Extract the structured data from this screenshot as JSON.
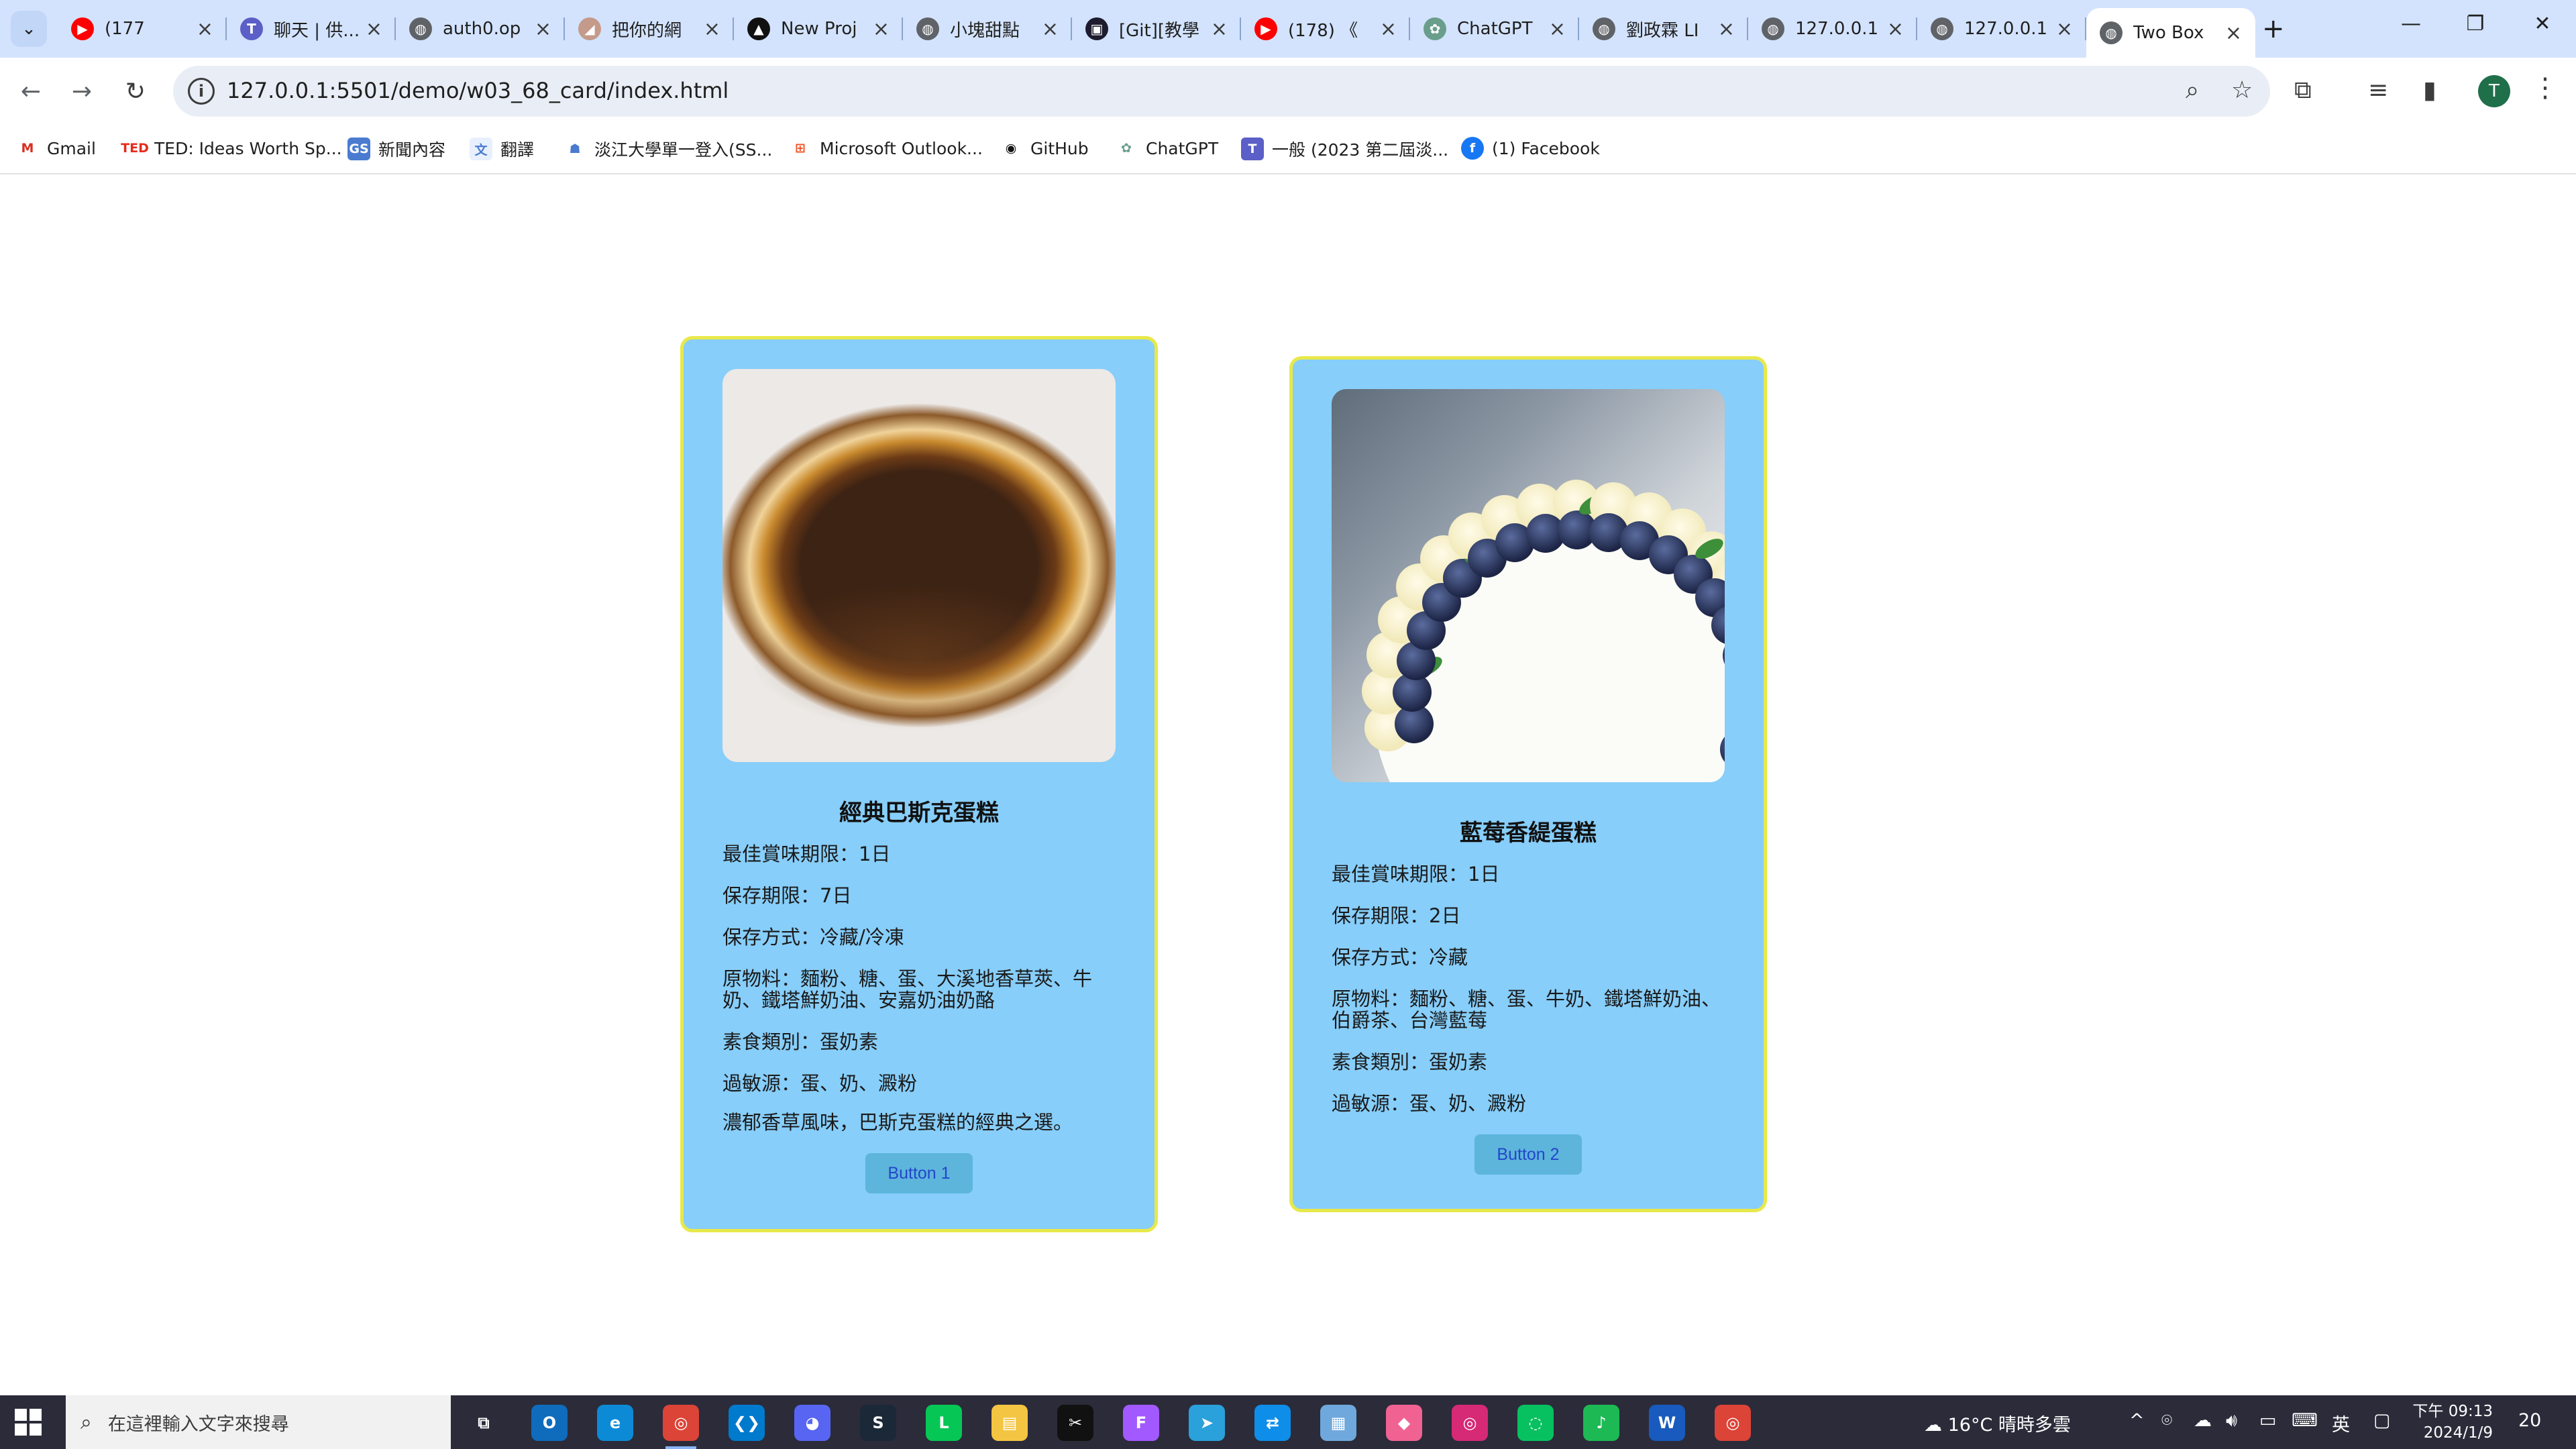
{
  "browser": {
    "tabs": [
      {
        "label": "(177",
        "icon": "youtube-icon",
        "color": "#ff0000"
      },
      {
        "label": "聊天 | 供...",
        "icon": "teams-icon",
        "color": "#5b5fc7"
      },
      {
        "label": "auth0.op",
        "icon": "globe-icon",
        "color": "#5f6368"
      },
      {
        "label": "把你的網",
        "icon": "mountain-icon",
        "color": "#c49a8a"
      },
      {
        "label": "New Proj",
        "icon": "triangle-icon",
        "color": "#111111"
      },
      {
        "label": "小塊甜點",
        "icon": "globe-icon",
        "color": "#5f6368"
      },
      {
        "label": "[Git][教學",
        "icon": "square-logo-icon",
        "color": "#1e1b2e"
      },
      {
        "label": "(178) 《",
        "icon": "youtube-icon",
        "color": "#ff0000"
      },
      {
        "label": "ChatGPT",
        "icon": "chatgpt-icon",
        "color": "#6a9e8c"
      },
      {
        "label": "劉政霖 LI",
        "icon": "globe-icon",
        "color": "#5f6368"
      },
      {
        "label": "127.0.0.1",
        "icon": "globe-icon",
        "color": "#5f6368"
      },
      {
        "label": "127.0.0.1",
        "icon": "globe-icon",
        "color": "#5f6368"
      },
      {
        "label": "Two Box",
        "icon": "globe-icon",
        "color": "#5f6368"
      }
    ],
    "new_tab": "+",
    "url": "127.0.0.1:5501/demo/w03_68_card/index.html",
    "profile_initial": "T",
    "bookmarks": [
      {
        "label": "Gmail",
        "icon": "gmail-icon"
      },
      {
        "label": "TED: Ideas Worth Sp...",
        "icon": "ted-icon",
        "icon_text": "TED"
      },
      {
        "label": "新聞內容",
        "icon": "gs-icon",
        "icon_text": "GS"
      },
      {
        "label": "翻譯",
        "icon": "translate-icon"
      },
      {
        "label": "淡江大學單一登入(SS...",
        "icon": "tku-icon"
      },
      {
        "label": "Microsoft Outlook...",
        "icon": "microsoft-icon"
      },
      {
        "label": "GitHub",
        "icon": "github-icon"
      },
      {
        "label": "ChatGPT",
        "icon": "chatgpt-icon"
      },
      {
        "label": "一般 (2023 第二屆淡...",
        "icon": "teams-icon"
      },
      {
        "label": "(1) Facebook",
        "icon": "facebook-icon",
        "icon_text": "f"
      }
    ]
  },
  "cards": [
    {
      "title": "經典巴斯克蛋糕",
      "image": "basque-cheesecake-photo",
      "specs": [
        "最佳賞味期限：1日",
        "保存期限：7日",
        "保存方式：冷藏/冷凍",
        "原物料：麵粉、糖、蛋、大溪地香草莢、牛奶、鐵塔鮮奶油、安嘉奶油奶酪",
        "素食類別：蛋奶素",
        "過敏源：蛋、奶、澱粉"
      ],
      "description": "濃郁香草風味，巴斯克蛋糕的經典之選。",
      "button": "Button 1"
    },
    {
      "title": "藍莓香緹蛋糕",
      "image": "blueberry-chantilly-cake-photo",
      "specs": [
        "最佳賞味期限：1日",
        "保存期限：2日",
        "保存方式：冷藏",
        "原物料：麵粉、糖、蛋、牛奶、鐵塔鮮奶油、伯爵茶、台灣藍莓",
        "素食類別：蛋奶素",
        "過敏源：蛋、奶、澱粉"
      ],
      "button": "Button 2"
    }
  ],
  "colors": {
    "card_bg": "#87cefa",
    "card_border": "#e8e84a",
    "button_bg": "#5db5dc",
    "button_text": "#2446c9",
    "tab_strip": "#d3e3fd",
    "taskbar": "#2b2b3a"
  },
  "taskbar": {
    "search_placeholder": "在這裡輸入文字來搜尋",
    "weather": "16°C  晴時多雲",
    "ime": "英",
    "time": "下午 09:13",
    "date": "2024/1/9",
    "notification_count": "20",
    "apps": [
      "task-view-icon",
      "outlook-icon",
      "edge-icon",
      "chrome-icon",
      "vscode-icon",
      "discord-icon",
      "steam-icon",
      "line-icon",
      "file-explorer-icon",
      "capcut-icon",
      "figma-icon",
      "telegram-icon",
      "teamviewer-icon",
      "notepad-icon",
      "paint-icon",
      "instagram-icon",
      "wechat-icon",
      "spotify-icon",
      "word-icon",
      "chrome-icon"
    ]
  }
}
